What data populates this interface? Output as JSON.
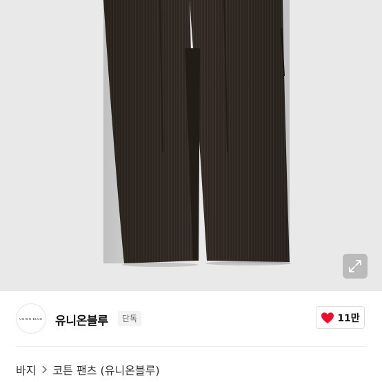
{
  "product_image": {
    "alt": "",
    "expand_icon": "expand-arrows-icon"
  },
  "brand": {
    "logo_text": "UNION BLUE",
    "name": "유니온블루",
    "badge": "단독"
  },
  "like": {
    "icon": "heart-icon",
    "count": "11만"
  },
  "breadcrumb": {
    "items": [
      "바지",
      "코튼 팬츠 (유니온블루)"
    ],
    "separator_icon": "chevron-right-icon"
  },
  "colors": {
    "heart": "#e8102c",
    "photo_bg": "#e9e9ea",
    "pants": "#2f2822"
  }
}
